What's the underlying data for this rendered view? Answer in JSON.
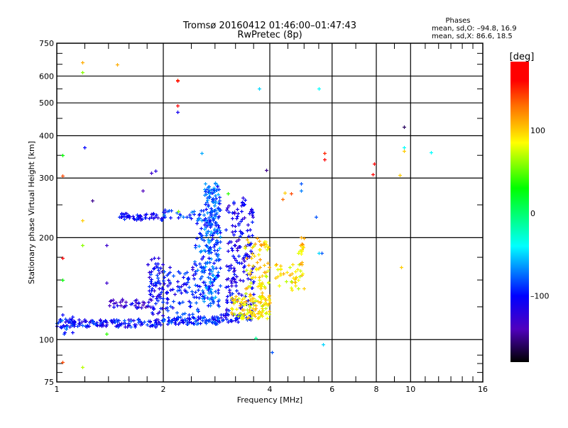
{
  "chart_data": {
    "type": "scatter",
    "title": "Tromsø 20160412 01:46:00–01:47:43",
    "subtitle": "RwPretec (8p)",
    "stats": {
      "heading": "Phases",
      "o_line": "mean, sd,O: –94.8, 16.9",
      "x_line": "mean, sd,X:  86.6, 18.5"
    },
    "xlabel": "Frequency [MHz]",
    "ylabel": "Stationary phase Virtual Height [km]",
    "xscale": "log",
    "yscale": "log",
    "xlim": [
      1,
      16
    ],
    "ylim": [
      75,
      750
    ],
    "xticks": [
      "1",
      "2",
      "4",
      "6",
      "8",
      "10",
      "16"
    ],
    "xtick_values": [
      1,
      2,
      4,
      6,
      8,
      10,
      16
    ],
    "yticks": [
      "75",
      "100",
      "200",
      "300",
      "400",
      "500",
      "600",
      "750"
    ],
    "ytick_values": [
      75,
      100,
      200,
      300,
      400,
      500,
      600,
      750
    ],
    "grid": true,
    "colorbar": {
      "label": "[deg]",
      "range": [
        -180,
        183
      ],
      "ticks": [
        "100",
        "0",
        "–100"
      ],
      "tick_values": [
        100,
        0,
        -100
      ]
    },
    "clusters_note": "dense echo regions: [fmin, fmax, hmin, hmax, phase_deg, count]",
    "clusters": [
      [
        1.0,
        2.0,
        109,
        115,
        -100,
        140
      ],
      [
        2.0,
        2.9,
        111,
        117,
        -95,
        80
      ],
      [
        2.9,
        3.6,
        113,
        120,
        -100,
        40
      ],
      [
        1.0,
        1.12,
        104,
        120,
        -90,
        18
      ],
      [
        1.5,
        2.0,
        226,
        236,
        -105,
        50
      ],
      [
        2.0,
        2.9,
        228,
        242,
        -90,
        40
      ],
      [
        2.6,
        2.9,
        125,
        290,
        -80,
        220
      ],
      [
        2.45,
        2.6,
        120,
        230,
        -85,
        50
      ],
      [
        3.0,
        3.6,
        120,
        265,
        -110,
        170
      ],
      [
        1.8,
        2.0,
        118,
        175,
        -105,
        70
      ],
      [
        2.0,
        2.5,
        113,
        165,
        -100,
        80
      ],
      [
        1.4,
        1.85,
        124,
        132,
        -120,
        35
      ],
      [
        3.1,
        4.0,
        115,
        135,
        90,
        110
      ],
      [
        3.4,
        4.0,
        130,
        200,
        95,
        80
      ],
      [
        4.0,
        5.0,
        140,
        170,
        90,
        40
      ],
      [
        4.8,
        5.0,
        165,
        200,
        100,
        15
      ]
    ],
    "points_note": "isolated echoes: [freq_MHz, height_km, phase_deg]",
    "points": [
      [
        1.04,
        86,
        140
      ],
      [
        1.18,
        83,
        70
      ],
      [
        1.18,
        660,
        110
      ],
      [
        1.18,
        615,
        60
      ],
      [
        1.48,
        650,
        110
      ],
      [
        2.19,
        585,
        140
      ],
      [
        2.19,
        580,
        160
      ],
      [
        2.19,
        490,
        170
      ],
      [
        2.19,
        470,
        -110
      ],
      [
        3.73,
        550,
        -50
      ],
      [
        5.5,
        550,
        -40
      ],
      [
        9.6,
        425,
        -160
      ],
      [
        1.2,
        370,
        -100
      ],
      [
        2.57,
        355,
        -60
      ],
      [
        5.7,
        355,
        150
      ],
      [
        5.7,
        340,
        170
      ],
      [
        9.6,
        370,
        -40
      ],
      [
        9.6,
        360,
        100
      ],
      [
        11.4,
        358,
        -40
      ],
      [
        7.8,
        307,
        170
      ],
      [
        7.9,
        330,
        170
      ],
      [
        9.3,
        306,
        100
      ],
      [
        3.9,
        317,
        -150
      ],
      [
        1.04,
        305,
        140
      ],
      [
        1.04,
        350,
        30
      ],
      [
        1.26,
        258,
        -150
      ],
      [
        1.18,
        225,
        100
      ],
      [
        1.18,
        190,
        60
      ],
      [
        1.38,
        190,
        -130
      ],
      [
        1.04,
        174,
        170
      ],
      [
        1.04,
        150,
        30
      ],
      [
        1.38,
        147,
        -130
      ],
      [
        9.4,
        164,
        100
      ],
      [
        5.65,
        97,
        -50
      ],
      [
        1.38,
        104,
        40
      ],
      [
        3.65,
        101,
        -10
      ],
      [
        4.05,
        92,
        -80
      ],
      [
        4.4,
        272,
        100
      ],
      [
        4.6,
        270,
        140
      ],
      [
        4.9,
        289,
        -80
      ],
      [
        4.9,
        275,
        -70
      ],
      [
        4.35,
        260,
        130
      ],
      [
        5.4,
        230,
        -80
      ],
      [
        5.6,
        180,
        -80
      ],
      [
        5.5,
        180,
        -50
      ],
      [
        4.9,
        200,
        110
      ],
      [
        3.05,
        270,
        40
      ],
      [
        2.7,
        270,
        -60
      ],
      [
        1.85,
        310,
        -130
      ],
      [
        1.9,
        315,
        -120
      ],
      [
        1.75,
        275,
        -140
      ],
      [
        2.2,
        240,
        60
      ]
    ]
  }
}
